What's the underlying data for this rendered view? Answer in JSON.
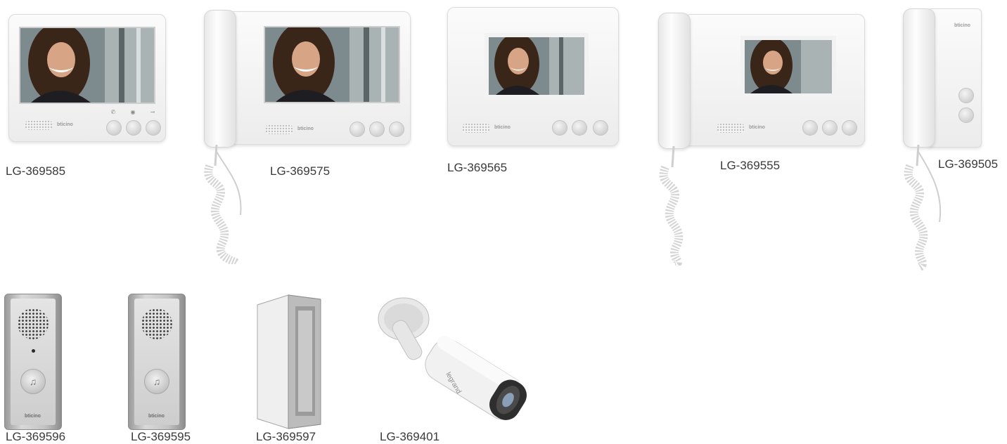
{
  "brand": "bticino",
  "camera_brand": "legrand",
  "products": [
    {
      "code": "LG-369585",
      "type": "video-monitor-7in"
    },
    {
      "code": "LG-369575",
      "type": "video-monitor-7in-handset"
    },
    {
      "code": "LG-369565",
      "type": "video-monitor-4in"
    },
    {
      "code": "LG-369555",
      "type": "video-monitor-4in-handset"
    },
    {
      "code": "LG-369505",
      "type": "audio-handset"
    },
    {
      "code": "LG-369596",
      "type": "outdoor-video-panel"
    },
    {
      "code": "LG-369595",
      "type": "outdoor-audio-panel"
    },
    {
      "code": "LG-369597",
      "type": "angled-mounting-bracket"
    },
    {
      "code": "LG-369401",
      "type": "bullet-camera"
    }
  ],
  "icons": {
    "call": "handset-icon",
    "camera": "eye-icon",
    "door": "key-icon",
    "bell": "bell-icon"
  },
  "colors": {
    "label_text": "#3a3a3a",
    "device_white": "#f7f7f7",
    "aluminium": "#c4c4c4"
  }
}
